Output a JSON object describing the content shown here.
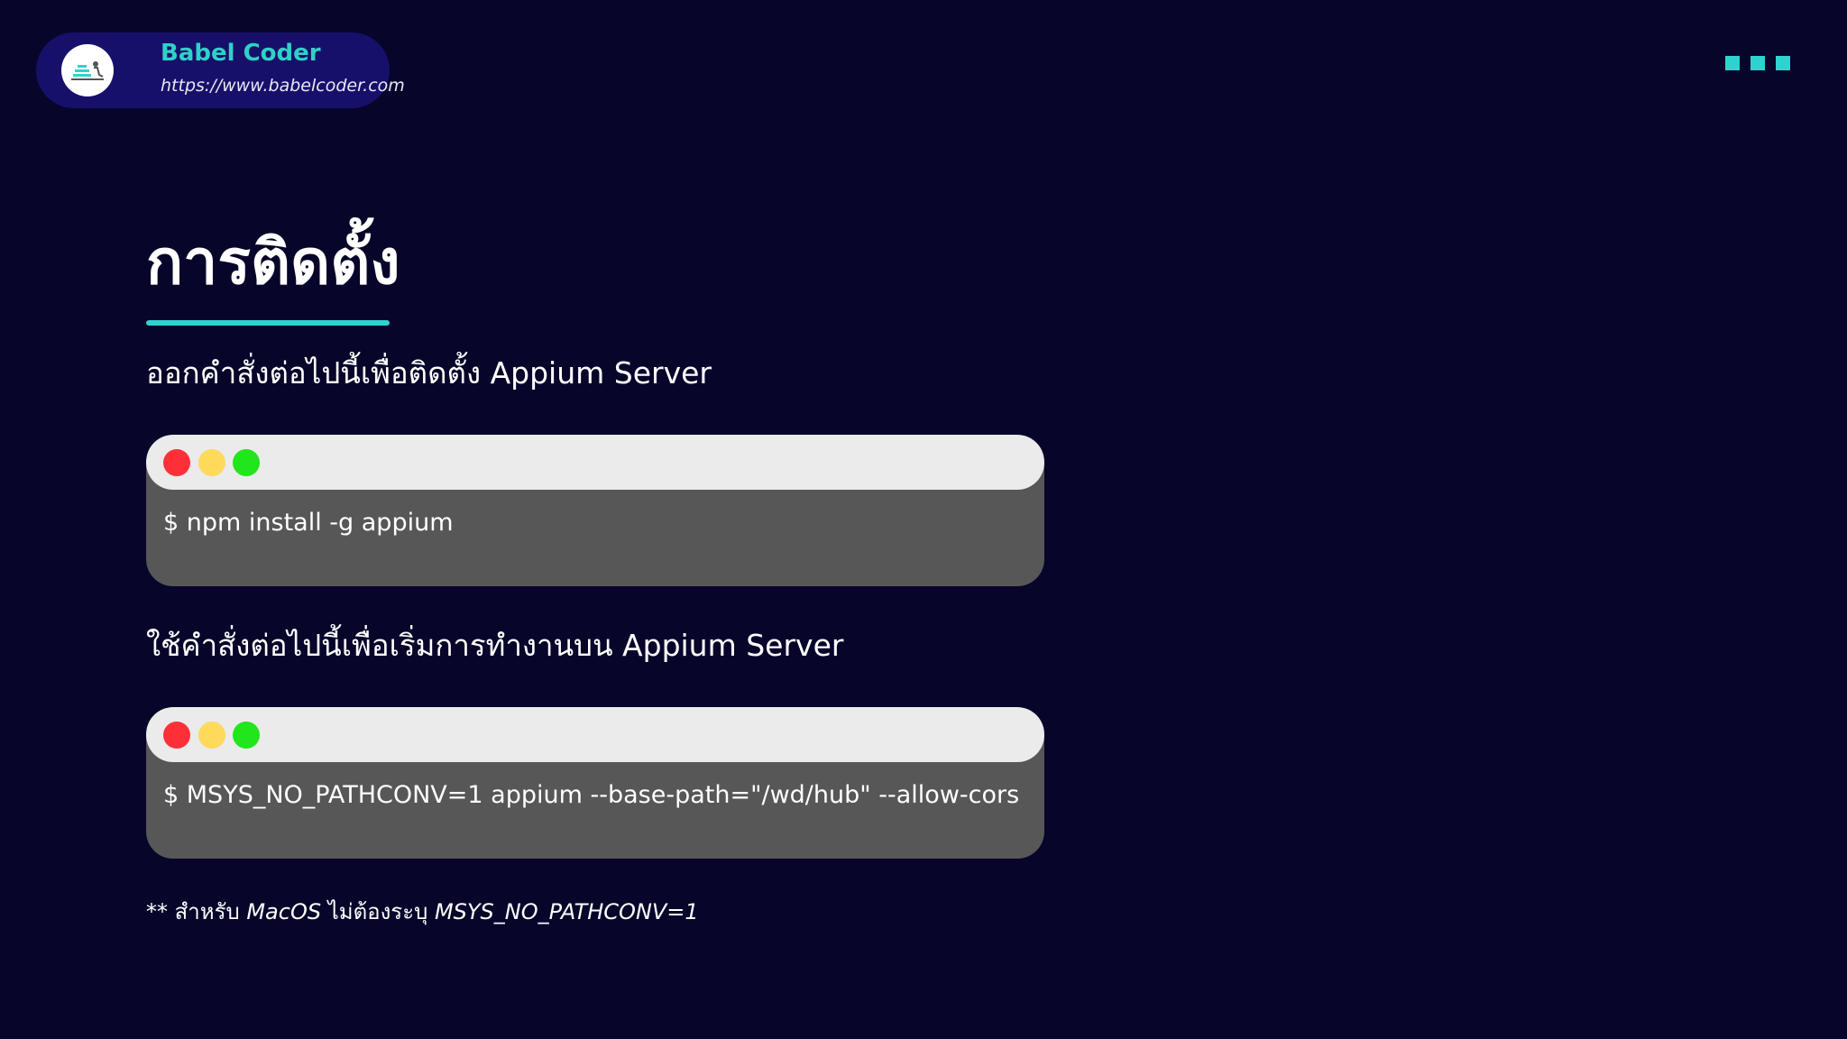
{
  "brand": {
    "name": "Babel Coder",
    "url": "https://www.babelcoder.com"
  },
  "title": "การติดตั้ง",
  "sections": [
    {
      "instruction": "ออกคำสั่งต่อไปนี้เพื่อติดตั้ง Appium Server",
      "command": "$ npm install -g appium"
    },
    {
      "instruction": "ใช้คำสั่งต่อไปนี้เพื่อเริ่มการทำงานบน Appium Server",
      "command": "$ MSYS_NO_PATHCONV=1 appium --base-path=\"/wd/hub\" --allow-cors"
    }
  ],
  "footnote": {
    "prefix": "** สำหรับ ",
    "os": "MacOS",
    "middle": " ไม่ต้องระบุ ",
    "env": "MSYS_NO_PATHCONV=1"
  },
  "colors": {
    "background": "#07052a",
    "accent": "#2ed3d0",
    "brand_pill": "#17106a",
    "terminal_body": "#575757",
    "terminal_bar": "#ebebeb",
    "light_red": "#ff3038",
    "light_yellow": "#ffd95a",
    "light_green": "#21e61c"
  },
  "icons": {
    "logo": "babel-coder-logo",
    "window_controls": [
      "close-dot",
      "minimize-dot",
      "maximize-dot"
    ],
    "decoration": "three-squares"
  }
}
